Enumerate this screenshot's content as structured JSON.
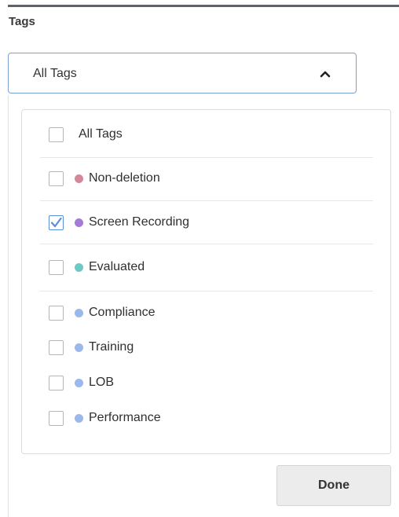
{
  "section": {
    "label": "Tags"
  },
  "dropdown": {
    "value": "All Tags",
    "expanded": true,
    "chevron": "chevron-up-icon"
  },
  "options": [
    {
      "label": "All Tags",
      "checked": false
    },
    {
      "label": "Non-deletion",
      "checked": false,
      "color": "#d4899a"
    },
    {
      "label": "Screen Recording",
      "checked": true,
      "color": "#a57bd6"
    },
    {
      "label": "Evaluated",
      "checked": false,
      "color": "#6ec9c6"
    },
    {
      "label": "Compliance",
      "checked": false,
      "color": "#9bb8ec"
    },
    {
      "label": "Training",
      "checked": false,
      "color": "#9bb8ec"
    },
    {
      "label": "LOB",
      "checked": false,
      "color": "#9bb8ec"
    },
    {
      "label": "Performance",
      "checked": false,
      "color": "#9bb8ec"
    }
  ],
  "done_label": "Done",
  "colors": {
    "accent": "#5b8ed8",
    "dropdown_border": "#7aa0d6"
  }
}
